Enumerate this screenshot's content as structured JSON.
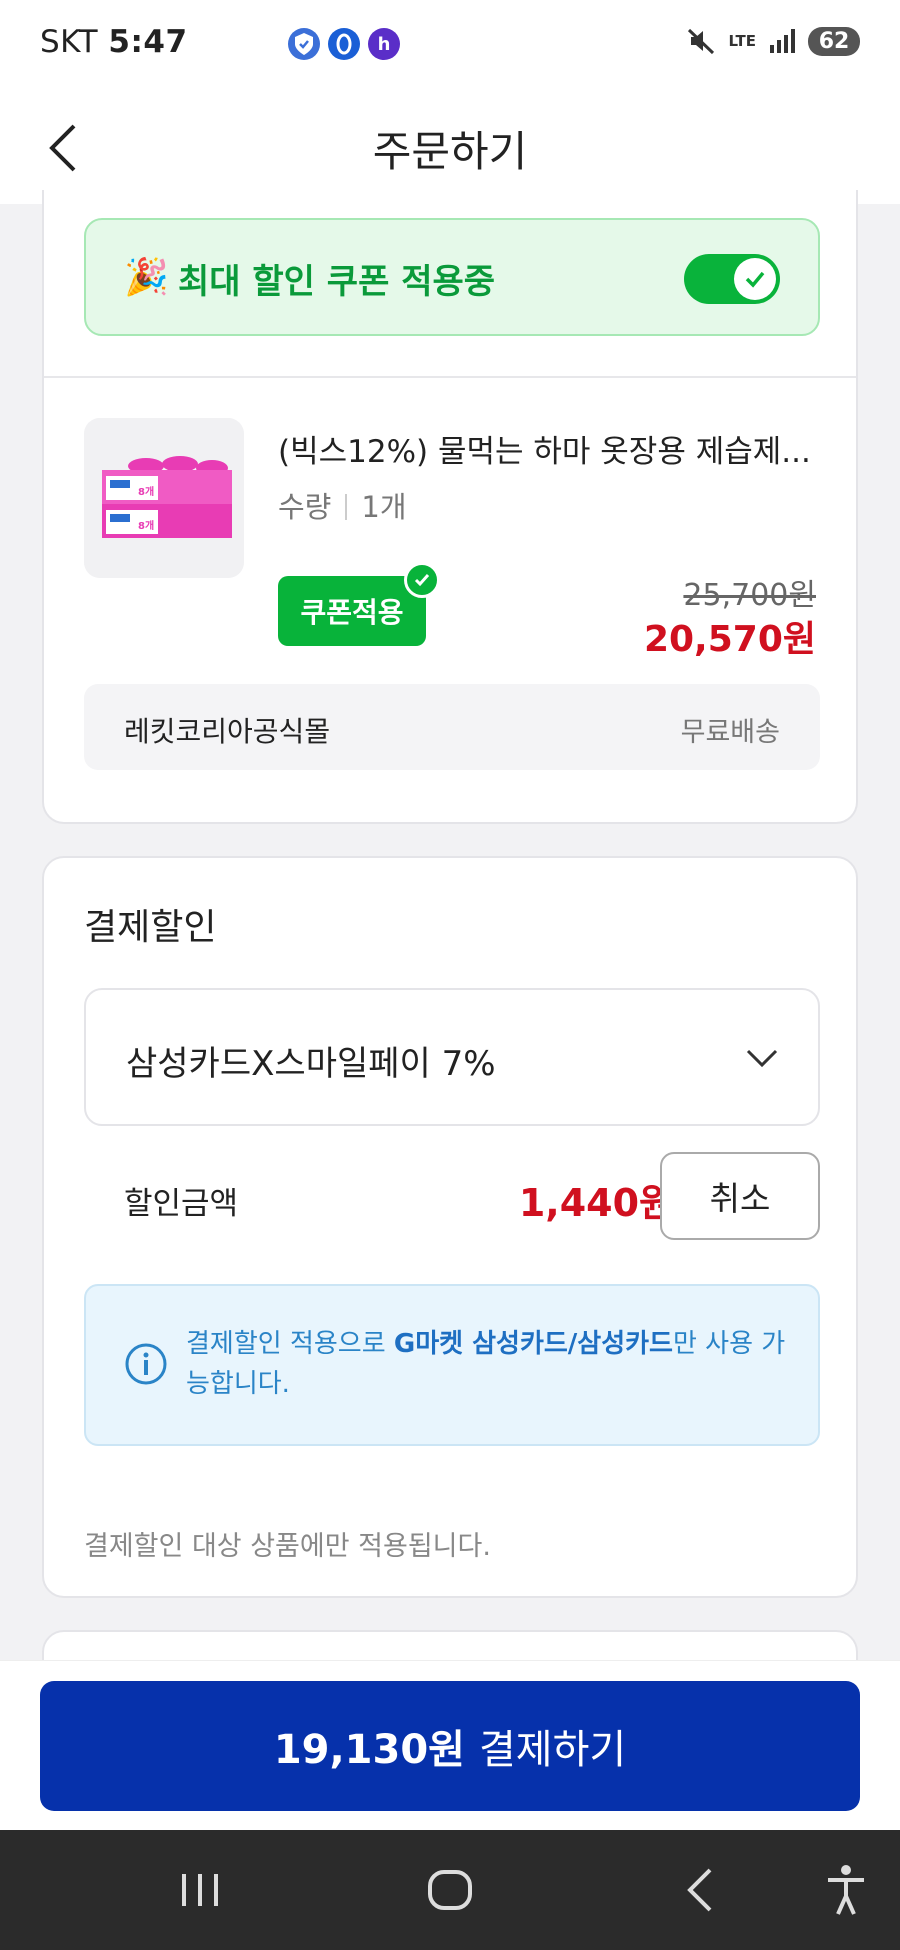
{
  "status_bar": {
    "carrier": "SKT",
    "time": "5:47",
    "network": "LTE",
    "battery": "62"
  },
  "header": {
    "title": "주문하기"
  },
  "coupon_banner": {
    "emoji": "🎉",
    "text": "최대 할인 쿠폰 적용중",
    "toggle_on": true,
    "toggle_color": "#09b33b"
  },
  "product": {
    "title": "(빅스12%) 물먹는 하마 옷장용 제습제...",
    "quantity_label": "수량",
    "quantity_value": "1개",
    "coupon_badge": "쿠폰적용",
    "original_price": "25,700원",
    "sale_price": "20,570원",
    "thumb_box_label": "8개",
    "seller": "레킷코리아공식몰",
    "delivery": "무료배송"
  },
  "payment_discount": {
    "title": "결제할인",
    "selected_card": "삼성카드X스마일페이 7%",
    "discount_label": "할인금액",
    "discount_amount": "1,440원",
    "cancel_label": "취소",
    "info_before": "결제할인 적용으로 ",
    "info_bold": "G마켓 삼성카드/삼성카드",
    "info_after": "만 사용 가능합니다.",
    "footnote": "결제할인 대상 상품에만 적용됩니다."
  },
  "checkout": {
    "amount": "19,130원",
    "label": "결제하기",
    "button_color": "#0631ab"
  },
  "colors": {
    "accent_green": "#08b33a",
    "price_red": "#d0101f",
    "info_blue": "#2a84c7"
  }
}
